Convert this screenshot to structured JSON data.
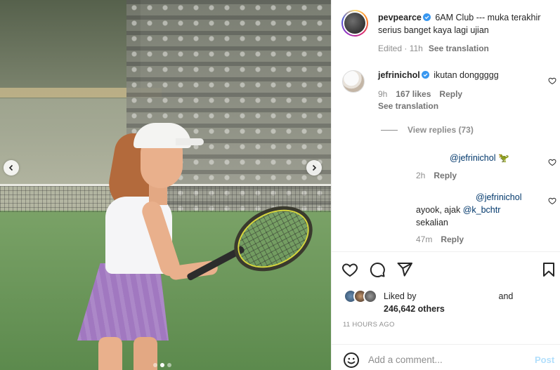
{
  "post": {
    "author": "pevpearce",
    "caption": "6AM Club --- muka terakhir serius banget kaya lagi ujian",
    "edited_label": "Edited · 11h",
    "see_translation": "See translation"
  },
  "comment": {
    "author": "jefrinichol",
    "text": "ikutan donggggg",
    "time": "9h",
    "likes": "167 likes",
    "reply_label": "Reply",
    "see_translation": "See translation",
    "view_replies": "View replies (73)"
  },
  "replies": [
    {
      "mention": "@jefrinichol",
      "text": "🦖",
      "time": "2h",
      "reply_label": "Reply"
    },
    {
      "mention": "@jefrinichol",
      "text_prefix": "ayook, ajak ",
      "text_mention": "@k_bchtr",
      "text_suffix": "sekalian",
      "time": "47m",
      "reply_label": "Reply"
    }
  ],
  "likes": {
    "liked_by": "Liked by",
    "and": "and",
    "count": "246,642 others"
  },
  "timestamp": "11 HOURS AGO",
  "composer": {
    "placeholder": "Add a comment...",
    "post_label": "Post"
  },
  "carousel": {
    "total": 3,
    "active": 2
  },
  "colors": {
    "accent": "#0095f6",
    "verified": "#3897f0",
    "post_disabled": "#b2dffc",
    "mention": "#00376b"
  }
}
